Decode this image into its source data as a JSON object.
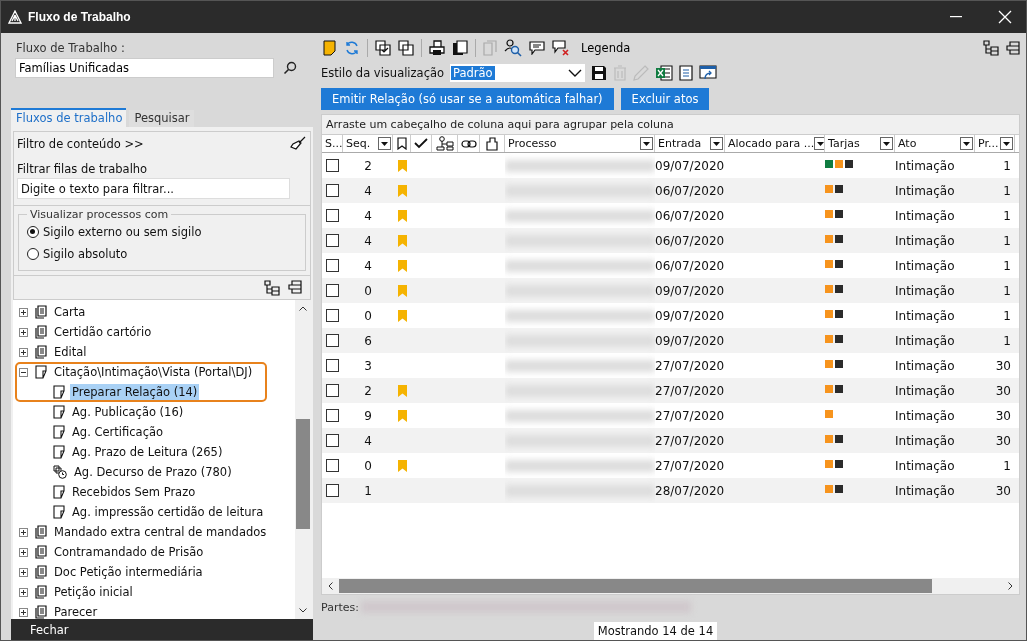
{
  "window": {
    "title": "Fluxo de Trabalho"
  },
  "left": {
    "workflow_label": "Fluxo de Trabalho :",
    "workflow_value": "Famílias Unificadas",
    "tabs": [
      {
        "label": "Fluxos de trabalho",
        "selected": true
      },
      {
        "label": "Pesquisar",
        "selected": false
      }
    ],
    "content_filter": "Filtro de conteúdo >>",
    "queue_filter_label": "Filtrar filas de trabalho",
    "queue_filter_placeholder": "Digite o texto para filtrar...",
    "group_title": "Visualizar processos com",
    "radios": [
      {
        "label": "Sigilo externo ou sem sigilo",
        "selected": true
      },
      {
        "label": "Sigilo absoluto",
        "selected": false
      }
    ],
    "tree": [
      {
        "label": "Carta",
        "kind": "stack",
        "expanded": false,
        "selected": false
      },
      {
        "label": "Certidão cartório",
        "kind": "stack",
        "expanded": false,
        "selected": false
      },
      {
        "label": "Edital",
        "kind": "stack",
        "expanded": false,
        "selected": false
      },
      {
        "label": "Citação\\Intimação\\Vista (Portal\\DJ)",
        "kind": "page",
        "expanded": true,
        "selected": false,
        "children": [
          {
            "label": "Preparar Relação (14)",
            "kind": "page",
            "selected": true
          },
          {
            "label": "Ag. Publicação (16)",
            "kind": "page",
            "selected": false
          },
          {
            "label": "Ag. Certificação",
            "kind": "page",
            "selected": false
          },
          {
            "label": "Ag. Prazo de Leitura (265)",
            "kind": "page",
            "selected": false
          },
          {
            "label": "Ag. Decurso de Prazo (780)",
            "kind": "clock",
            "selected": false
          },
          {
            "label": "Recebidos Sem Prazo",
            "kind": "page",
            "selected": false
          },
          {
            "label": "Ag. impressão certidão de leitura",
            "kind": "page",
            "selected": false
          }
        ]
      },
      {
        "label": "Mandado extra central de mandados",
        "kind": "stack",
        "expanded": false,
        "selected": false
      },
      {
        "label": "Contramandado de Prisão",
        "kind": "stack",
        "expanded": false,
        "selected": false
      },
      {
        "label": "Doc Petição intermediária",
        "kind": "stack",
        "expanded": false,
        "selected": false
      },
      {
        "label": "Petição inicial",
        "kind": "stack",
        "expanded": false,
        "selected": false
      },
      {
        "label": "Parecer",
        "kind": "stack",
        "expanded": false,
        "selected": false
      }
    ],
    "close_button": "Fechar"
  },
  "toolbar": {
    "legend": "Legenda",
    "view_style_label": "Estilo da visualização",
    "view_style_value": "Padrão",
    "buttons": [
      "Emitir Relação (só usar se a automática falhar)",
      "Excluir atos"
    ]
  },
  "table": {
    "group_hint": "Arraste um cabeçalho de coluna aqui para agrupar pela coluna",
    "columns": [
      {
        "label": "S...",
        "filter": false
      },
      {
        "label": "Seq.",
        "filter": true
      },
      {
        "label": "Processo",
        "filter": true
      },
      {
        "label": "Entrada",
        "filter": true
      },
      {
        "label": "Alocado para ...",
        "filter": true
      },
      {
        "label": "Tarjas",
        "filter": true
      },
      {
        "label": "Ato",
        "filter": true
      },
      {
        "label": "Pr...",
        "filter": true
      }
    ],
    "rows": [
      {
        "checked": false,
        "seq": "2",
        "bookmarked": true,
        "entrada": "09/07/2020",
        "tarjas": [
          {
            "color": "#107c41"
          },
          {
            "color": "#f7941d"
          },
          {
            "color": "#2b2b2b"
          }
        ],
        "ato": "Intimação",
        "prazo": "1"
      },
      {
        "checked": false,
        "seq": "4",
        "bookmarked": true,
        "entrada": "06/07/2020",
        "tarjas": [
          {
            "color": "#f7941d"
          },
          {
            "color": "#2b2b2b"
          }
        ],
        "ato": "Intimação",
        "prazo": "1"
      },
      {
        "checked": false,
        "seq": "4",
        "bookmarked": true,
        "entrada": "06/07/2020",
        "tarjas": [
          {
            "color": "#f7941d"
          },
          {
            "color": "#2b2b2b"
          }
        ],
        "ato": "Intimação",
        "prazo": "1"
      },
      {
        "checked": false,
        "seq": "4",
        "bookmarked": true,
        "entrada": "06/07/2020",
        "tarjas": [
          {
            "color": "#f7941d"
          },
          {
            "color": "#2b2b2b"
          }
        ],
        "ato": "Intimação",
        "prazo": "1"
      },
      {
        "checked": false,
        "seq": "4",
        "bookmarked": true,
        "entrada": "06/07/2020",
        "tarjas": [
          {
            "color": "#f7941d"
          },
          {
            "color": "#2b2b2b"
          }
        ],
        "ato": "Intimação",
        "prazo": "1"
      },
      {
        "checked": false,
        "seq": "0",
        "bookmarked": true,
        "entrada": "09/07/2020",
        "tarjas": [
          {
            "color": "#f7941d"
          },
          {
            "color": "#2b2b2b"
          }
        ],
        "ato": "Intimação",
        "prazo": "1"
      },
      {
        "checked": false,
        "seq": "0",
        "bookmarked": true,
        "entrada": "09/07/2020",
        "tarjas": [
          {
            "color": "#f7941d"
          },
          {
            "color": "#2b2b2b"
          }
        ],
        "ato": "Intimação",
        "prazo": "1"
      },
      {
        "checked": false,
        "seq": "6",
        "bookmarked": false,
        "entrada": "09/07/2020",
        "tarjas": [
          {
            "color": "#f7941d"
          },
          {
            "color": "#2b2b2b"
          }
        ],
        "ato": "Intimação",
        "prazo": "1"
      },
      {
        "checked": false,
        "seq": "3",
        "bookmarked": false,
        "entrada": "27/07/2020",
        "tarjas": [
          {
            "color": "#f7941d"
          },
          {
            "color": "#2b2b2b"
          }
        ],
        "ato": "Intimação",
        "prazo": "30"
      },
      {
        "checked": false,
        "seq": "2",
        "bookmarked": true,
        "entrada": "27/07/2020",
        "tarjas": [
          {
            "color": "#f7941d"
          },
          {
            "color": "#2b2b2b"
          }
        ],
        "ato": "Intimação",
        "prazo": "30"
      },
      {
        "checked": false,
        "seq": "9",
        "bookmarked": true,
        "entrada": "27/07/2020",
        "tarjas": [
          {
            "color": "#f7941d"
          }
        ],
        "ato": "Intimação",
        "prazo": "30"
      },
      {
        "checked": false,
        "seq": "4",
        "bookmarked": false,
        "entrada": "27/07/2020",
        "tarjas": [
          {
            "color": "#f7941d"
          },
          {
            "color": "#2b2b2b"
          }
        ],
        "ato": "Intimação",
        "prazo": "30"
      },
      {
        "checked": false,
        "seq": "0",
        "bookmarked": true,
        "entrada": "27/07/2020",
        "tarjas": [
          {
            "color": "#f7941d"
          },
          {
            "color": "#2b2b2b"
          }
        ],
        "ato": "Intimação",
        "prazo": "1"
      },
      {
        "checked": false,
        "seq": "1",
        "bookmarked": false,
        "entrada": "28/07/2020",
        "tarjas": [
          {
            "color": "#f7941d"
          },
          {
            "color": "#2b2b2b"
          }
        ],
        "ato": "Intimação",
        "prazo": "30"
      }
    ]
  },
  "parts_label": "Partes:",
  "status": "Mostrando 14 de 14"
}
